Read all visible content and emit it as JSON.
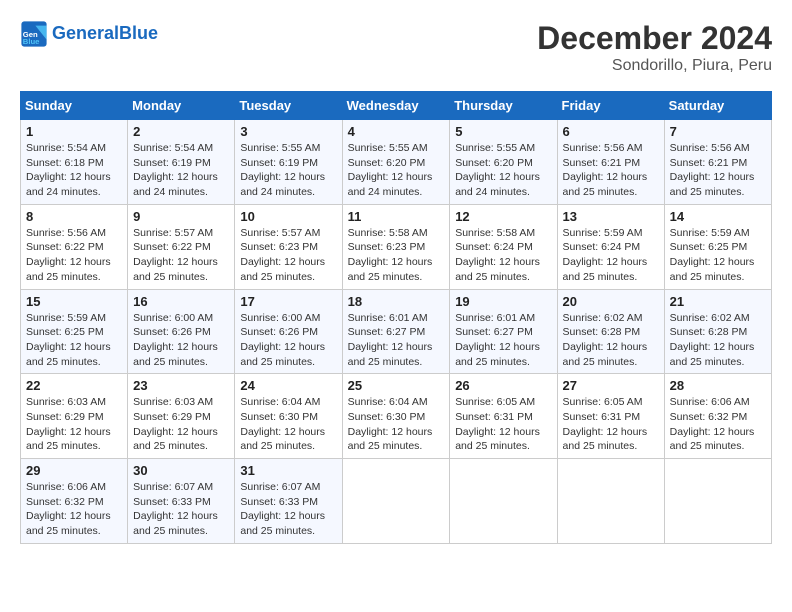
{
  "logo": {
    "text_general": "General",
    "text_blue": "Blue"
  },
  "title": "December 2024",
  "subtitle": "Sondorillo, Piura, Peru",
  "weekdays": [
    "Sunday",
    "Monday",
    "Tuesday",
    "Wednesday",
    "Thursday",
    "Friday",
    "Saturday"
  ],
  "weeks": [
    [
      {
        "day": "1",
        "info": "Sunrise: 5:54 AM\nSunset: 6:18 PM\nDaylight: 12 hours\nand 24 minutes."
      },
      {
        "day": "2",
        "info": "Sunrise: 5:54 AM\nSunset: 6:19 PM\nDaylight: 12 hours\nand 24 minutes."
      },
      {
        "day": "3",
        "info": "Sunrise: 5:55 AM\nSunset: 6:19 PM\nDaylight: 12 hours\nand 24 minutes."
      },
      {
        "day": "4",
        "info": "Sunrise: 5:55 AM\nSunset: 6:20 PM\nDaylight: 12 hours\nand 24 minutes."
      },
      {
        "day": "5",
        "info": "Sunrise: 5:55 AM\nSunset: 6:20 PM\nDaylight: 12 hours\nand 24 minutes."
      },
      {
        "day": "6",
        "info": "Sunrise: 5:56 AM\nSunset: 6:21 PM\nDaylight: 12 hours\nand 25 minutes."
      },
      {
        "day": "7",
        "info": "Sunrise: 5:56 AM\nSunset: 6:21 PM\nDaylight: 12 hours\nand 25 minutes."
      }
    ],
    [
      {
        "day": "8",
        "info": "Sunrise: 5:56 AM\nSunset: 6:22 PM\nDaylight: 12 hours\nand 25 minutes."
      },
      {
        "day": "9",
        "info": "Sunrise: 5:57 AM\nSunset: 6:22 PM\nDaylight: 12 hours\nand 25 minutes."
      },
      {
        "day": "10",
        "info": "Sunrise: 5:57 AM\nSunset: 6:23 PM\nDaylight: 12 hours\nand 25 minutes."
      },
      {
        "day": "11",
        "info": "Sunrise: 5:58 AM\nSunset: 6:23 PM\nDaylight: 12 hours\nand 25 minutes."
      },
      {
        "day": "12",
        "info": "Sunrise: 5:58 AM\nSunset: 6:24 PM\nDaylight: 12 hours\nand 25 minutes."
      },
      {
        "day": "13",
        "info": "Sunrise: 5:59 AM\nSunset: 6:24 PM\nDaylight: 12 hours\nand 25 minutes."
      },
      {
        "day": "14",
        "info": "Sunrise: 5:59 AM\nSunset: 6:25 PM\nDaylight: 12 hours\nand 25 minutes."
      }
    ],
    [
      {
        "day": "15",
        "info": "Sunrise: 5:59 AM\nSunset: 6:25 PM\nDaylight: 12 hours\nand 25 minutes."
      },
      {
        "day": "16",
        "info": "Sunrise: 6:00 AM\nSunset: 6:26 PM\nDaylight: 12 hours\nand 25 minutes."
      },
      {
        "day": "17",
        "info": "Sunrise: 6:00 AM\nSunset: 6:26 PM\nDaylight: 12 hours\nand 25 minutes."
      },
      {
        "day": "18",
        "info": "Sunrise: 6:01 AM\nSunset: 6:27 PM\nDaylight: 12 hours\nand 25 minutes."
      },
      {
        "day": "19",
        "info": "Sunrise: 6:01 AM\nSunset: 6:27 PM\nDaylight: 12 hours\nand 25 minutes."
      },
      {
        "day": "20",
        "info": "Sunrise: 6:02 AM\nSunset: 6:28 PM\nDaylight: 12 hours\nand 25 minutes."
      },
      {
        "day": "21",
        "info": "Sunrise: 6:02 AM\nSunset: 6:28 PM\nDaylight: 12 hours\nand 25 minutes."
      }
    ],
    [
      {
        "day": "22",
        "info": "Sunrise: 6:03 AM\nSunset: 6:29 PM\nDaylight: 12 hours\nand 25 minutes."
      },
      {
        "day": "23",
        "info": "Sunrise: 6:03 AM\nSunset: 6:29 PM\nDaylight: 12 hours\nand 25 minutes."
      },
      {
        "day": "24",
        "info": "Sunrise: 6:04 AM\nSunset: 6:30 PM\nDaylight: 12 hours\nand 25 minutes."
      },
      {
        "day": "25",
        "info": "Sunrise: 6:04 AM\nSunset: 6:30 PM\nDaylight: 12 hours\nand 25 minutes."
      },
      {
        "day": "26",
        "info": "Sunrise: 6:05 AM\nSunset: 6:31 PM\nDaylight: 12 hours\nand 25 minutes."
      },
      {
        "day": "27",
        "info": "Sunrise: 6:05 AM\nSunset: 6:31 PM\nDaylight: 12 hours\nand 25 minutes."
      },
      {
        "day": "28",
        "info": "Sunrise: 6:06 AM\nSunset: 6:32 PM\nDaylight: 12 hours\nand 25 minutes."
      }
    ],
    [
      {
        "day": "29",
        "info": "Sunrise: 6:06 AM\nSunset: 6:32 PM\nDaylight: 12 hours\nand 25 minutes."
      },
      {
        "day": "30",
        "info": "Sunrise: 6:07 AM\nSunset: 6:33 PM\nDaylight: 12 hours\nand 25 minutes."
      },
      {
        "day": "31",
        "info": "Sunrise: 6:07 AM\nSunset: 6:33 PM\nDaylight: 12 hours\nand 25 minutes."
      },
      null,
      null,
      null,
      null
    ]
  ]
}
